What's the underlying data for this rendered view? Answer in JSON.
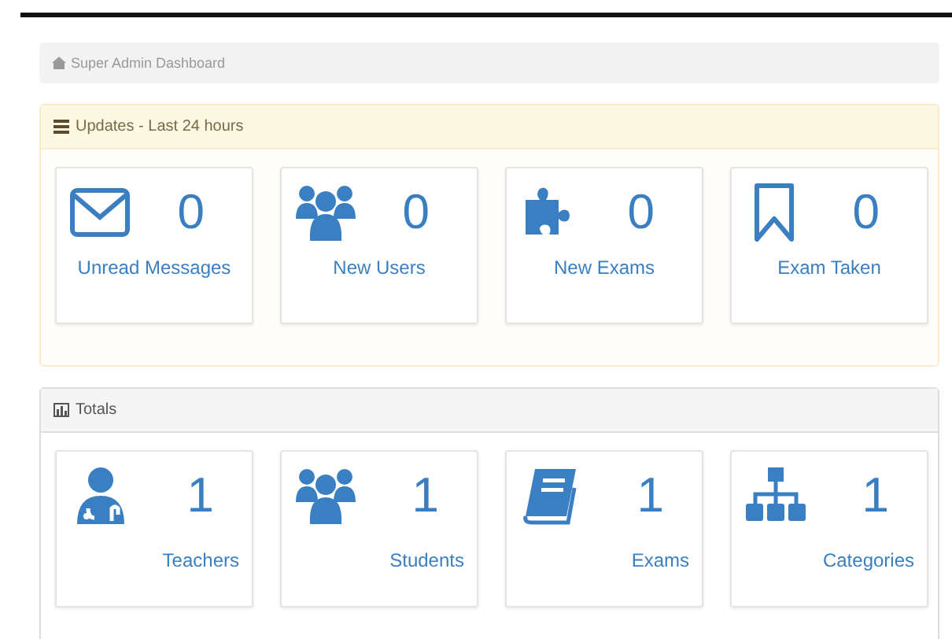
{
  "breadcrumb": {
    "label": "Super Admin Dashboard"
  },
  "panels": [
    {
      "title": "Updates - Last 24 hours",
      "kind": "updates",
      "stats": [
        {
          "kind": "envelope",
          "count": "0",
          "label": "Unread Messages"
        },
        {
          "kind": "users",
          "count": "0",
          "label": "New Users"
        },
        {
          "kind": "puzzle",
          "count": "0",
          "label": "New Exams"
        },
        {
          "kind": "bookmark",
          "count": "0",
          "label": "Exam Taken"
        }
      ]
    },
    {
      "title": "Totals",
      "kind": "totals",
      "stats": [
        {
          "kind": "doctor",
          "count": "1",
          "label": "Teachers"
        },
        {
          "kind": "users",
          "count": "1",
          "label": "Students"
        },
        {
          "kind": "book",
          "count": "1",
          "label": "Exams"
        },
        {
          "kind": "sitemap",
          "count": "1",
          "label": "Categories"
        }
      ]
    }
  ]
}
